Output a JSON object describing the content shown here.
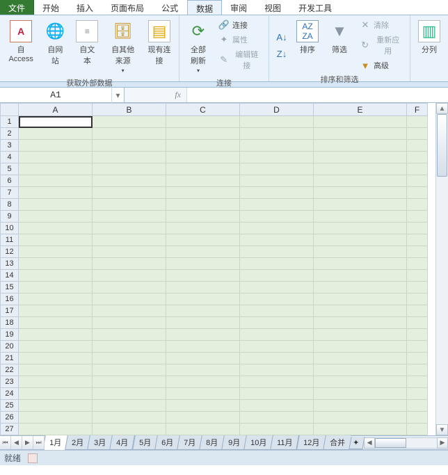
{
  "tabs": {
    "file": "文件",
    "home": "开始",
    "insert": "插入",
    "pagelayout": "页面布局",
    "formulas": "公式",
    "data": "数据",
    "review": "审阅",
    "view": "视图",
    "developer": "开发工具"
  },
  "ribbon": {
    "get_external": {
      "access": "自 Access",
      "web": "自网站",
      "text": "自文本",
      "other": "自其他来源",
      "existing": "现有连接",
      "group_label": "获取外部数据"
    },
    "connections": {
      "refresh_all": "全部刷新",
      "connections": "连接",
      "properties": "属性",
      "edit_links": "编辑链接",
      "group_label": "连接"
    },
    "sort_filter": {
      "sort": "排序",
      "filter": "筛选",
      "clear": "清除",
      "reapply": "重新应用",
      "advanced": "高级",
      "group_label": "排序和筛选"
    },
    "cols": "分列"
  },
  "namebox": "A1",
  "fx_label": "fx",
  "columns": [
    "A",
    "B",
    "C",
    "D",
    "E",
    "F"
  ],
  "rows": [
    "1",
    "2",
    "3",
    "4",
    "5",
    "6",
    "7",
    "8",
    "9",
    "10",
    "11",
    "12",
    "13",
    "14",
    "15",
    "16",
    "17",
    "18",
    "19",
    "20",
    "21",
    "22",
    "23",
    "24",
    "25",
    "26",
    "27"
  ],
  "sheet_tabs": [
    "1月",
    "2月",
    "3月",
    "4月",
    "5月",
    "6月",
    "7月",
    "8月",
    "9月",
    "10月",
    "11月",
    "12月",
    "合并"
  ],
  "status": "就绪"
}
